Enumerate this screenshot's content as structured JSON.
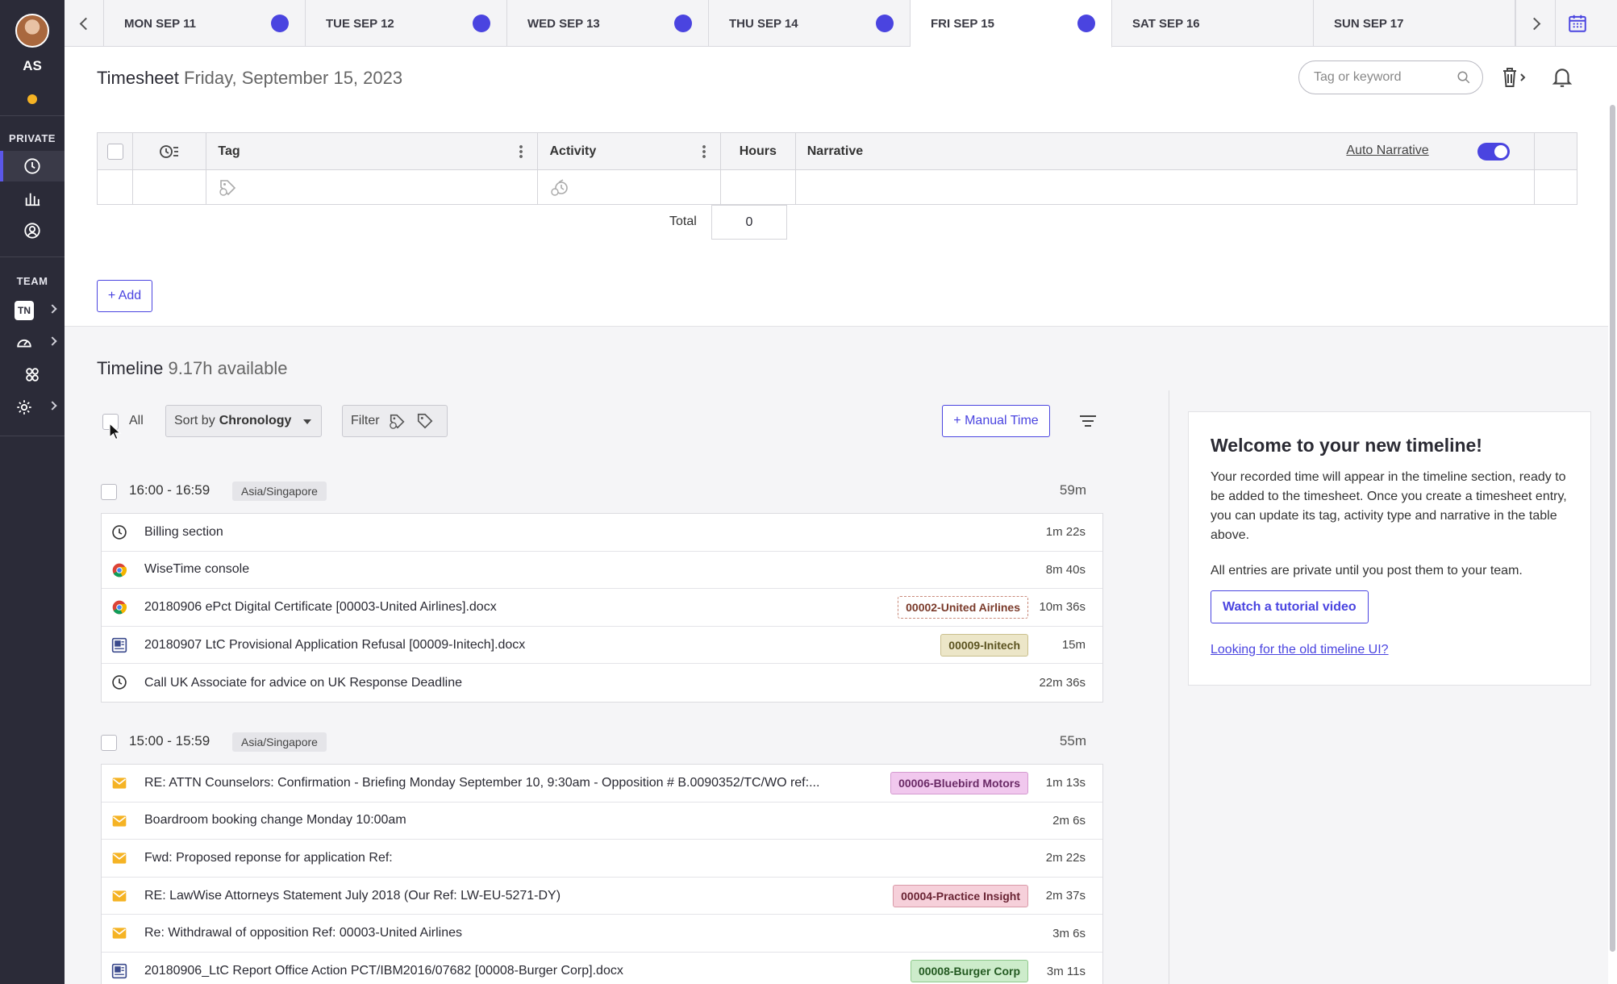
{
  "sidebar": {
    "initials": "AS",
    "private_label": "PRIVATE",
    "team_label": "TEAM",
    "team_badge": "TN"
  },
  "days": {
    "tabs": [
      {
        "label": "MON SEP 11",
        "has_dot": true
      },
      {
        "label": "TUE SEP 12",
        "has_dot": true
      },
      {
        "label": "WED SEP 13",
        "has_dot": true
      },
      {
        "label": "THU SEP 14",
        "has_dot": true
      },
      {
        "label": "FRI SEP 15",
        "has_dot": true,
        "active": true
      },
      {
        "label": "SAT SEP 16",
        "has_dot": false
      },
      {
        "label": "SUN SEP 17",
        "has_dot": false
      }
    ]
  },
  "timesheet": {
    "title": "Timesheet",
    "date": "Friday, September 15, 2023",
    "search_placeholder": "Tag or keyword",
    "columns": {
      "tag": "Tag",
      "activity": "Activity",
      "hours": "Hours",
      "narrative": "Narrative"
    },
    "auto_narrative": "Auto Narrative",
    "total_label": "Total",
    "total_value": "0",
    "add_label": "+ Add"
  },
  "timeline": {
    "title": "Timeline",
    "available": "9.17h available",
    "all_label": "All",
    "sort_prefix": "Sort by",
    "sort_value": "Chronology",
    "filter_label": "Filter",
    "manual_label": "+ Manual Time",
    "groups": [
      {
        "time": "16:00 - 16:59",
        "tz": "Asia/Singapore",
        "duration": "59m",
        "entries": [
          {
            "icon": "clock-icon",
            "text": "Billing section",
            "duration": "1m 22s"
          },
          {
            "icon": "chrome-icon",
            "text": "WiseTime console",
            "duration": "8m 40s"
          },
          {
            "icon": "chrome-icon",
            "text": "20180906 ePct Digital Certificate [00003-United Airlines].docx",
            "duration": "10m 36s",
            "tag": "00002-United Airlines",
            "tag_style": "dashed"
          },
          {
            "icon": "word-doc-icon",
            "text": "20180907 LtC Provisional Application Refusal [00009-Initech].docx",
            "duration": "15m",
            "tag": "00009-Initech",
            "tag_style": "tan"
          },
          {
            "icon": "clock-icon",
            "text": "Call UK Associate for advice on UK Response Deadline",
            "duration": "22m 36s"
          }
        ]
      },
      {
        "time": "15:00 - 15:59",
        "tz": "Asia/Singapore",
        "duration": "55m",
        "entries": [
          {
            "icon": "email-icon",
            "text": "RE: ATTN Counselors: Confirmation - Briefing Monday September 10, 9:30am - Opposition # B.0090352/TC/WO ref:...",
            "duration": "1m 13s",
            "tag": "00006-Bluebird Motors",
            "tag_style": "pink"
          },
          {
            "icon": "email-icon",
            "text": "Boardroom booking change Monday 10:00am",
            "duration": "2m 6s"
          },
          {
            "icon": "email-icon",
            "text": "Fwd: Proposed reponse for application Ref:",
            "duration": "2m 22s"
          },
          {
            "icon": "email-icon",
            "text": "RE: LawWise Attorneys Statement July 2018 (Our Ref: LW-EU-5271-DY)",
            "duration": "2m 37s",
            "tag": "00004-Practice Insight",
            "tag_style": "rose"
          },
          {
            "icon": "email-icon",
            "text": "Re: Withdrawal of opposition Ref: 00003-United Airlines",
            "duration": "3m 6s"
          },
          {
            "icon": "word-doc-icon",
            "text": "20180906_LtC Report Office Action PCT/IBM2016/07682 [00008-Burger Corp].docx",
            "duration": "3m 11s",
            "tag": "00008-Burger Corp",
            "tag_style": "green"
          }
        ]
      }
    ]
  },
  "welcome": {
    "title": "Welcome to your new timeline!",
    "para1": "Your recorded time will appear in the timeline section, ready to be added to the timesheet. Once you create a timesheet entry, you can update its tag, activity type and narrative in the table above.",
    "para2": "All entries are private until you post them to your team.",
    "watch_label": "Watch a tutorial video",
    "old_link": "Looking for the old timeline UI?"
  },
  "colors": {
    "accent": "#4a44e0",
    "sidebar": "#2b2b38",
    "status_dot": "#f5b324"
  }
}
